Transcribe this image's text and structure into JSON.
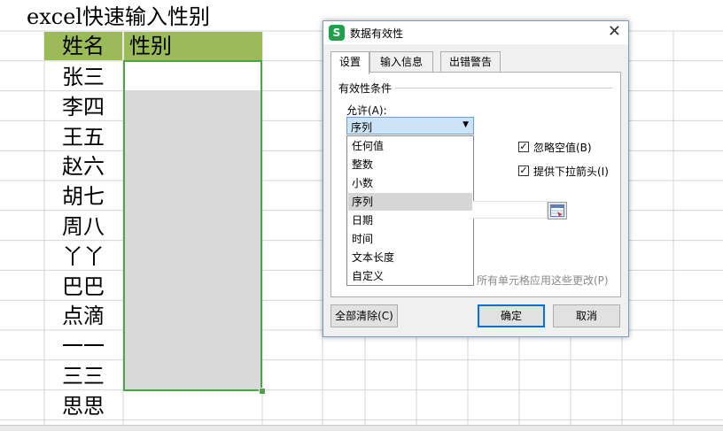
{
  "sheet": {
    "title_cell": "excel快速输入性别",
    "header": {
      "name": "姓名",
      "gender": "性别"
    },
    "names": [
      "张三",
      "李四",
      "王五",
      "赵六",
      "胡七",
      "周八",
      "丫丫",
      "巴巴",
      "点滴",
      "一一",
      "三三",
      "思思"
    ],
    "header_color": "#9bbb59",
    "selection_color": "#4ea24e"
  },
  "dialog": {
    "app_icon_letter": "S",
    "title": "数据有效性",
    "close_icon": "close-icon",
    "tabs": [
      "设置",
      "输入信息",
      "出错警告"
    ],
    "active_tab": "设置",
    "group_title": "有效性条件",
    "allow_label": "允许(A):",
    "allow_value": "序列",
    "dropdown_options": [
      "任何值",
      "整数",
      "小数",
      "序列",
      "日期",
      "时间",
      "文本长度",
      "自定义"
    ],
    "selected_option": "序列",
    "ignore_blank": {
      "label": "忽略空值(B)",
      "checked": true
    },
    "in_cell_dropdown": {
      "label": "提供下拉箭头(I)",
      "checked": true
    },
    "apply_all_text": "所有单元格应用这些更改(P)",
    "buttons": {
      "clear_all": "全部清除(C)",
      "ok": "确定",
      "cancel": "取消"
    }
  }
}
